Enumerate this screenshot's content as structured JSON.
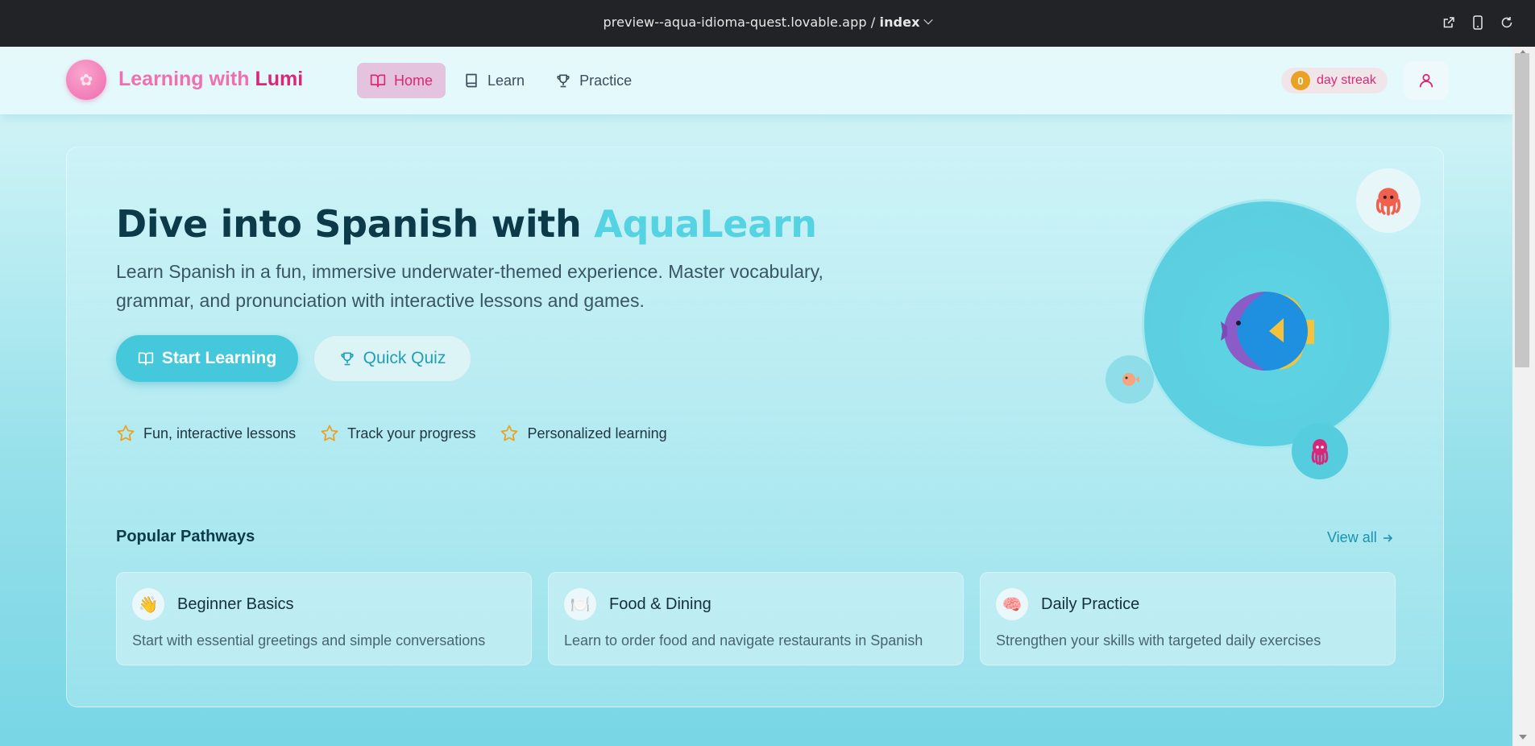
{
  "browser": {
    "url_host": "preview--aqua-idioma-quest.lovable.app",
    "url_separator": " / ",
    "url_page": "index",
    "icons": [
      "open-external-icon",
      "mobile-device-icon",
      "reload-icon"
    ]
  },
  "header": {
    "brand_prefix": "Learning with",
    "brand_accent": "Lumi",
    "logo_icon": "axolotl-icon",
    "nav": [
      {
        "label": "Home",
        "icon": "book-open-icon",
        "active": true
      },
      {
        "label": "Learn",
        "icon": "book-icon",
        "active": false
      },
      {
        "label": "Practice",
        "icon": "trophy-icon",
        "active": false
      }
    ],
    "streak": {
      "count": "0",
      "label": "day streak"
    },
    "user_icon": "user-icon"
  },
  "hero": {
    "title_prefix": "Dive into Spanish with",
    "title_accent": "AquaLearn",
    "subtitle": "Learn Spanish in a fun, immersive underwater-themed experience. Master vocabulary, grammar, and pronunciation with interactive lessons and games.",
    "primary_button": "Start Learning",
    "secondary_button": "Quick Quiz",
    "features": [
      "Fun, interactive lessons",
      "Track your progress",
      "Personalized learning"
    ]
  },
  "pathways": {
    "title": "Popular Pathways",
    "view_all": "View all",
    "cards": [
      {
        "icon": "waving-hand-icon",
        "emoji": "👋",
        "title": "Beginner Basics",
        "description": "Start with essential greetings and simple conversations"
      },
      {
        "icon": "plate-icon",
        "emoji": "🍽️",
        "title": "Food & Dining",
        "description": "Learn to order food and navigate restaurants in Spanish"
      },
      {
        "icon": "brain-icon",
        "emoji": "🧠",
        "title": "Daily Practice",
        "description": "Strengthen your skills with targeted daily exercises"
      }
    ]
  },
  "colors": {
    "brand_pink": "#db2777",
    "aqua_accent": "#55d3e3",
    "primary_button": "#45c8dc",
    "streak_badge": "#eaa224"
  }
}
